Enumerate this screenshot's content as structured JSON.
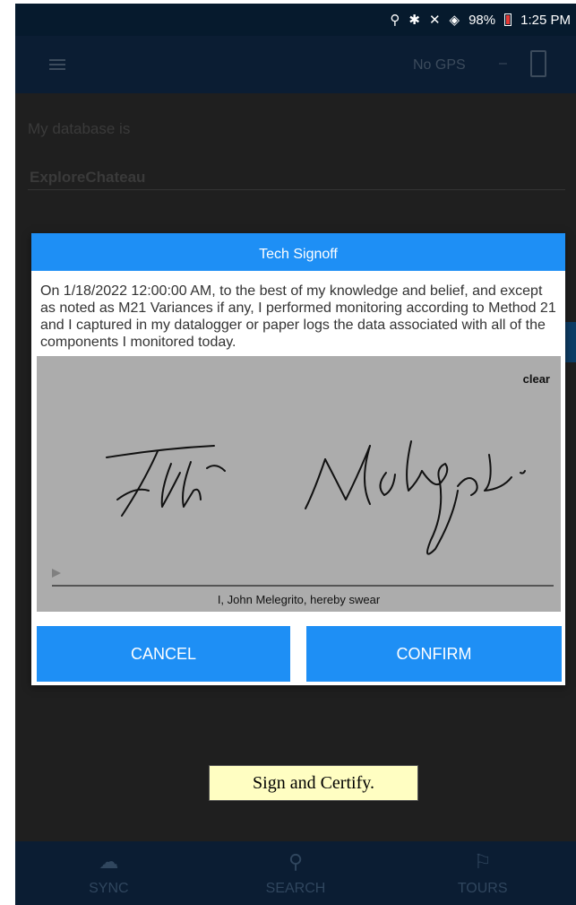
{
  "status_bar": {
    "battery": "98%",
    "time": "1:25 PM",
    "icons": [
      "location-icon",
      "bluetooth-icon",
      "mute-icon",
      "wifi-icon",
      "battery-icon"
    ]
  },
  "app_bar": {
    "gps_status": "No GPS",
    "separator": "–"
  },
  "background": {
    "db_label": "My database is",
    "db_value": "ExploreChateau"
  },
  "dialog": {
    "title": "Tech Signoff",
    "statement": "On 1/18/2022 12:00:00 AM, to the best of my knowledge and belief, and except as noted as M21 Variances if any, I performed monitoring according to Method 21 and I captured in my datalogger or paper logs the data associated with all of the components I monitored today.",
    "clear_label": "clear",
    "signature_caption": "I, John Melegrito, hereby swear",
    "cancel_label": "CANCEL",
    "confirm_label": "CONFIRM"
  },
  "bottom_nav": {
    "items": [
      {
        "label": "SYNC",
        "icon": "cloud-sync-icon"
      },
      {
        "label": "SEARCH",
        "icon": "search-icon"
      },
      {
        "label": "TOURS",
        "icon": "tours-icon"
      }
    ]
  },
  "annotation": {
    "text": "Sign and Certify."
  },
  "colors": {
    "accent": "#1e8ff5",
    "app_bar": "#0b1d33",
    "overlay_bg": "#1f1f1f",
    "signature_pad": "#acacac",
    "annotation_bg": "#fffec2"
  }
}
